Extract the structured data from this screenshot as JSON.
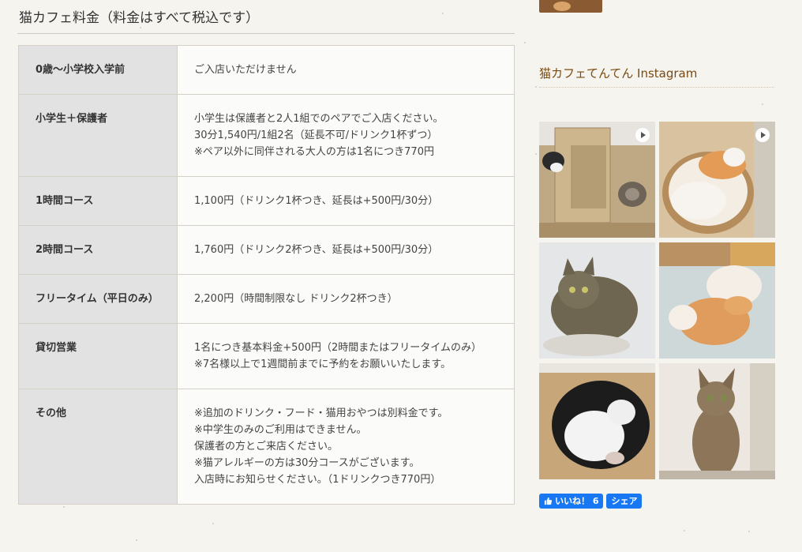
{
  "page": {
    "title": "猫カフェ料金（料金はすべて税込です）"
  },
  "price_table": {
    "rows": [
      {
        "label": "0歳〜小学校入学前",
        "lines": [
          "ご入店いただけません"
        ]
      },
      {
        "label": "小学生＋保護者",
        "lines": [
          "小学生は保護者と2人1組でのペアでご入店ください。",
          "30分1,540円/1組2名（延長不可/ドリンク1杯ずつ）",
          "※ペア以外に同伴される大人の方は1名につき770円"
        ]
      },
      {
        "label": "1時間コース",
        "lines": [
          "1,100円（ドリンク1杯つき、延長は+500円/30分）"
        ]
      },
      {
        "label": "2時間コース",
        "lines": [
          "1,760円（ドリンク2杯つき、延長は+500円/30分）"
        ]
      },
      {
        "label": "フリータイム（平日のみ）",
        "lines": [
          "2,200円（時間制限なし ドリンク2杯つき）"
        ]
      },
      {
        "label": "貸切営業",
        "lines": [
          "1名につき基本料金+500円（2時間またはフリータイムのみ）",
          "※7名様以上で1週間前までに予約をお願いいたします。"
        ]
      },
      {
        "label": "その他",
        "lines": [
          "※追加のドリンク・フード・猫用おやつは別料金です。",
          "※中学生のみのご利用はできません。",
          "保護者の方とご来店ください。",
          "※猫アレルギーの方は30分コースがございます。",
          "入店時にお知らせください。（1ドリンクつき770円）"
        ]
      }
    ]
  },
  "sidebar": {
    "instagram_title": "猫カフェてんてん Instagram",
    "photos": [
      {
        "name": "cats-in-box",
        "video": true
      },
      {
        "name": "orange-white-cats-basket",
        "video": true
      },
      {
        "name": "tabby-cat-sitting",
        "video": false
      },
      {
        "name": "orange-white-cats-bed",
        "video": false
      },
      {
        "name": "black-white-cat-box",
        "video": false
      },
      {
        "name": "abyssinian-cat",
        "video": false
      }
    ],
    "like_label": "いいね！ 6",
    "share_label": "シェア",
    "colors": {
      "facebook": "#1877f2",
      "title": "#7a4a10"
    }
  }
}
